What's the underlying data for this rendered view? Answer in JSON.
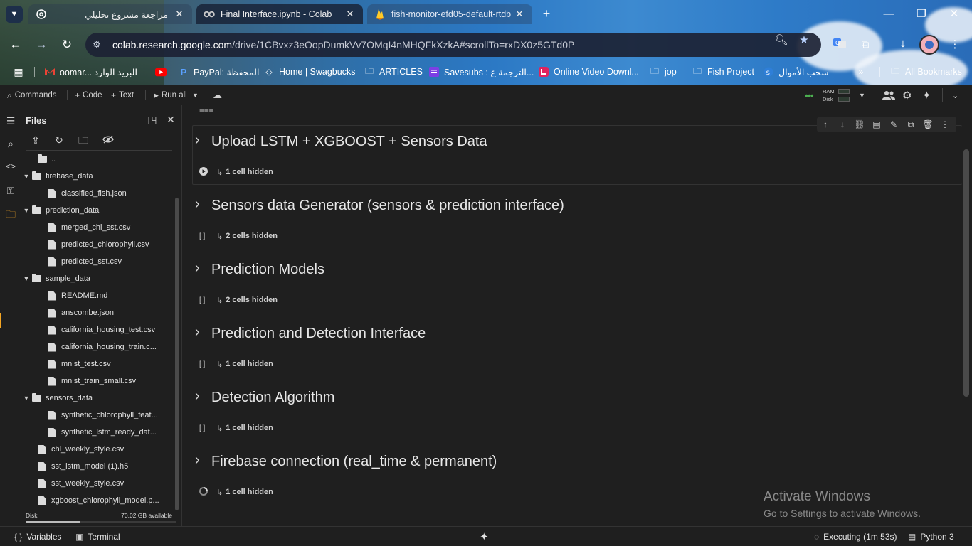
{
  "browser": {
    "tabs": [
      {
        "title": "مراجعة مشروع تحليلي",
        "favicon": "openai-icon",
        "active": false
      },
      {
        "title": "Final Interface.ipynb - Colab",
        "favicon": "colab-icon",
        "active": true
      },
      {
        "title": "fish-monitor-efd05-default-rtdb",
        "favicon": "firebase-icon",
        "active": false
      }
    ],
    "url_domain": "colab.research.google.com",
    "url_path": "/drive/1CBvxz3eOopDumkVv7OMqI4nMHQFkXzkA#scrollTo=rxDX0z5GTd0P",
    "bookmarks": [
      {
        "label": "oomar... البريد الوارد -",
        "icon": "gmail-icon"
      },
      {
        "label": "",
        "icon": "youtube-icon"
      },
      {
        "label": "PayPal: المحفظة",
        "icon": "paypal-icon"
      },
      {
        "label": "Home | Swagbucks",
        "icon": "swagbucks-icon"
      },
      {
        "label": "ARTICLES",
        "icon": "folder-icon"
      },
      {
        "label": "Savesubs : الترجمة ع...",
        "icon": "savesubs-icon"
      },
      {
        "label": "Online Video Downl...",
        "icon": "video-download-icon"
      },
      {
        "label": "jop",
        "icon": "folder-icon"
      },
      {
        "label": "Fish Project",
        "icon": "folder-icon"
      },
      {
        "label": "سحب الأموال",
        "icon": "withdraw-icon"
      }
    ],
    "all_bookmarks": "All Bookmarks"
  },
  "colab": {
    "commands": "Commands",
    "add_code": "Code",
    "add_text": "Text",
    "run_all": "Run all",
    "ram_label": "RAM",
    "disk_label": "Disk"
  },
  "files": {
    "title": "Files",
    "tree": [
      {
        "name": "..",
        "type": "folder",
        "depth": 0,
        "expanded": null
      },
      {
        "name": "firebase_data",
        "type": "folder",
        "depth": 0,
        "expanded": true
      },
      {
        "name": "classified_fish.json",
        "type": "file",
        "depth": 1
      },
      {
        "name": "prediction_data",
        "type": "folder",
        "depth": 0,
        "expanded": true
      },
      {
        "name": "merged_chl_sst.csv",
        "type": "file",
        "depth": 1
      },
      {
        "name": "predicted_chlorophyll.csv",
        "type": "file",
        "depth": 1
      },
      {
        "name": "predicted_sst.csv",
        "type": "file",
        "depth": 1
      },
      {
        "name": "sample_data",
        "type": "folder",
        "depth": 0,
        "expanded": true
      },
      {
        "name": "README.md",
        "type": "file",
        "depth": 1
      },
      {
        "name": "anscombe.json",
        "type": "file",
        "depth": 1
      },
      {
        "name": "california_housing_test.csv",
        "type": "file",
        "depth": 1
      },
      {
        "name": "california_housing_train.c...",
        "type": "file",
        "depth": 1
      },
      {
        "name": "mnist_test.csv",
        "type": "file",
        "depth": 1
      },
      {
        "name": "mnist_train_small.csv",
        "type": "file",
        "depth": 1
      },
      {
        "name": "sensors_data",
        "type": "folder",
        "depth": 0,
        "expanded": true
      },
      {
        "name": "synthetic_chlorophyll_feat...",
        "type": "file",
        "depth": 1
      },
      {
        "name": "synthetic_lstm_ready_dat...",
        "type": "file",
        "depth": 1
      },
      {
        "name": "chl_weekly_style.csv",
        "type": "file",
        "depth": 0
      },
      {
        "name": "sst_lstm_model (1).h5",
        "type": "file",
        "depth": 0
      },
      {
        "name": "sst_weekly_style.csv",
        "type": "file",
        "depth": 0
      },
      {
        "name": "xgboost_chlorophyll_model.p...",
        "type": "file",
        "depth": 0
      }
    ],
    "disk_label": "Disk",
    "disk_available": "70.02 GB available",
    "disk_used_fraction": 0.36
  },
  "notebook": {
    "sections": [
      {
        "title": "Upload LSTM + XGBOOST + Sensors Data",
        "hidden": "1 cell hidden",
        "run_state": "play"
      },
      {
        "title": "Sensors data Generator (sensors & prediction interface)",
        "hidden": "2 cells hidden",
        "run_state": "[ ]"
      },
      {
        "title": "Prediction Models",
        "hidden": "2 cells hidden",
        "run_state": "[ ]"
      },
      {
        "title": "Prediction and Detection Interface",
        "hidden": "1 cell hidden",
        "run_state": "[ ]"
      },
      {
        "title": "Detection Algorithm",
        "hidden": "1 cell hidden",
        "run_state": "[ ]"
      },
      {
        "title": "Firebase connection (real_time & permanent)",
        "hidden": "1 cell hidden",
        "run_state": "running"
      }
    ]
  },
  "watermark": {
    "line1": "Activate Windows",
    "line2": "Go to Settings to activate Windows."
  },
  "statusbar": {
    "variables": "Variables",
    "terminal": "Terminal",
    "executing": "Executing (1m 53s)",
    "runtime": "Python 3"
  },
  "colors": {
    "accent_orange": "#f5a623",
    "panel_bg": "#1f1f1f",
    "text": "#e3e3e3"
  }
}
